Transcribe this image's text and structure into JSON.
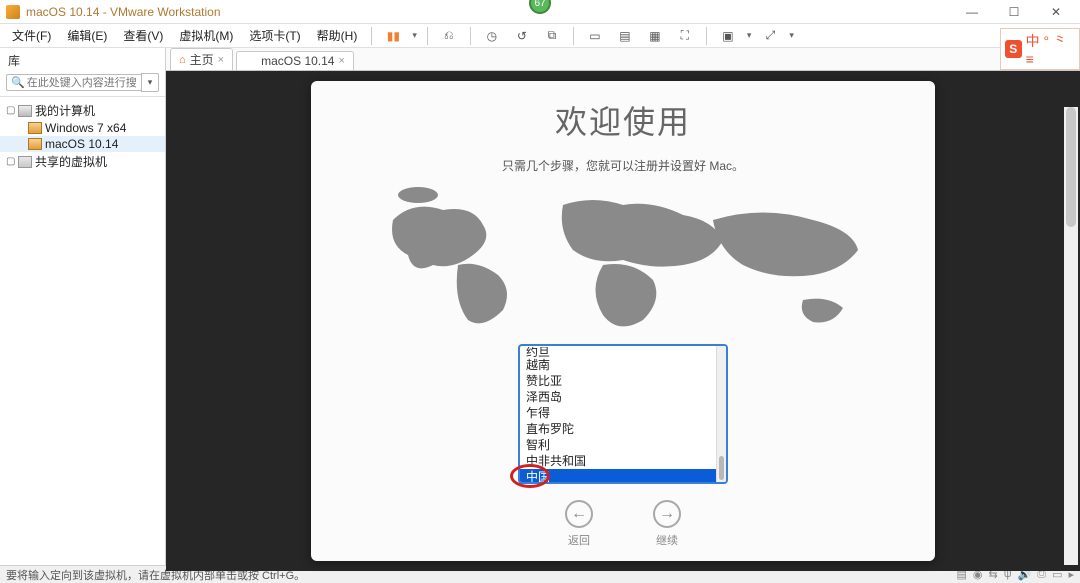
{
  "titlebar": {
    "title": "macOS 10.14 - VMware Workstation",
    "badge": "67",
    "min": "—",
    "max": "☐",
    "close": "✕"
  },
  "menubar": {
    "items": [
      "文件(F)",
      "编辑(E)",
      "查看(V)",
      "虚拟机(M)",
      "选项卡(T)",
      "帮助(H)"
    ]
  },
  "ime": {
    "logo": "S",
    "text": "中 ° ⺀ ≡"
  },
  "sidebar": {
    "header": "库",
    "searchPlaceholder": "在此处键入内容进行搜索",
    "tree": {
      "root": "我的计算机",
      "children": [
        "Windows 7 x64",
        "macOS 10.14"
      ],
      "shared": "共享的虚拟机"
    }
  },
  "tabs": {
    "home": "主页",
    "vm": "macOS 10.14"
  },
  "mac": {
    "title": "欢迎使用",
    "subtitle": "只需几个步骤，您就可以注册并设置好 Mac。",
    "countries": [
      "约旦",
      "越南",
      "赞比亚",
      "泽西岛",
      "乍得",
      "直布罗陀",
      "智利",
      "中非共和国",
      "中国"
    ],
    "selectedIndex": 8,
    "back": "返回",
    "continue": "继续"
  },
  "statusbar": {
    "text": "要将输入定向到该虚拟机，请在虚拟机内部单击或按 Ctrl+G。"
  }
}
